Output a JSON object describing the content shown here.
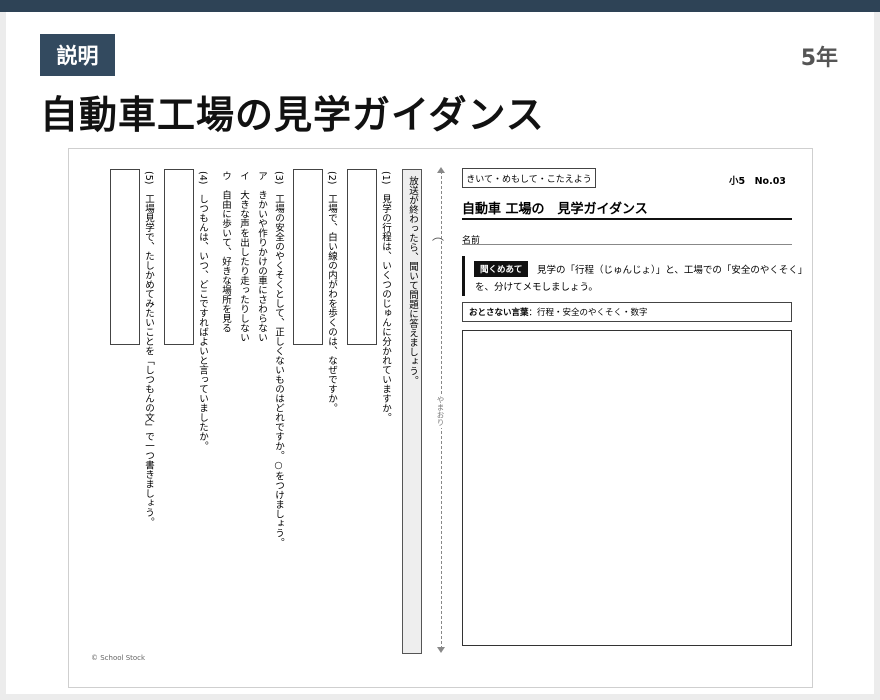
{
  "header": {
    "badge": "説明",
    "grade": "5年",
    "title": "自動車工場の見学ガイダンス"
  },
  "sheet": {
    "tag": "きいて・めもして・こたえよう",
    "number": "小5　No.03",
    "title": "自動車 工場の　見学ガイダンス",
    "name_label": "名前",
    "aim_label": "聞くめあて",
    "aim_line1": "見学の「行程（じゅんじょ）」と、工場での「安全のやくそく」",
    "aim_line2": "を、分けてメモしましょう。",
    "words_label": "おとさない言葉",
    "words_text": "：行程・安全のやくそく・数字",
    "fold_text": "やまおり",
    "fold_icon": "⌒",
    "strip_text": "放送が終わったら、聞いて問題に答えましょう。",
    "copyright": "© School Stock"
  },
  "questions": {
    "q1": "(1)　見学の行程は、いくつのじゅんに分かれていますか。",
    "q2": "(2)　工場で、白い線の内がわを歩くのは、なぜですか。",
    "q3": "(3)　工場の安全のやくそくとして、正しくないものはどれですか。○をつけましょう。",
    "q3a": "ア　きかいや作りかけの車にさわらない",
    "q3i": "イ　大きな声を出したり走ったりしない",
    "q3u": "ウ　自由に歩いて、好きな場所を見る",
    "q4": "(4)　しつもんは、いつ、どこですればよいと言っていましたか。",
    "q5": "(5)　工場見学で、たしかめてみたいことを「しつもんの文」で一つ書きましょう。"
  }
}
